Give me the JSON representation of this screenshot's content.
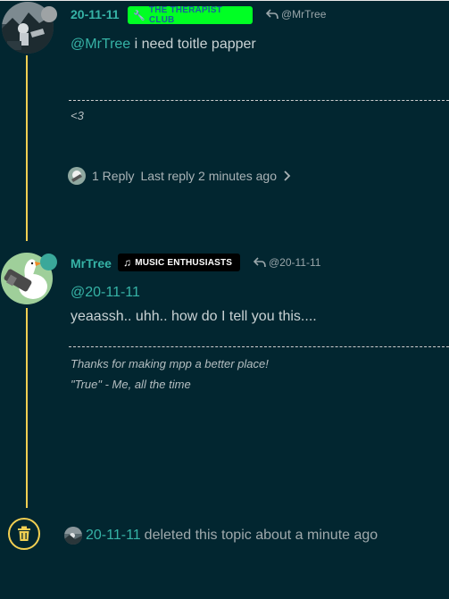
{
  "post1": {
    "username": "20-11-11",
    "badge": {
      "label": "THE THERAPIST CLUB",
      "bg": "#00ff24",
      "fg": "#1b5e9f",
      "icon": "wrench-icon"
    },
    "reply_to": "@MrTree",
    "mention": "@MrTree",
    "body": " i need toitle papper",
    "signature": "<3",
    "replies_label": "1 Reply",
    "last_reply": "Last reply 2 minutes ago"
  },
  "post2": {
    "username": "MrTree",
    "badge": {
      "label": "MUSIC ENTHUSIASTS",
      "bg": "#000000",
      "fg": "#ffffff",
      "icon": "music-note-icon"
    },
    "reply_to": "@20-11-11",
    "mention": "@20-11-11",
    "body": "yeaassh.. uhh.. how do I tell you this....",
    "signature_line1": "Thanks for making mpp a better place!",
    "signature_line2": "\"True\" - Me, all the time"
  },
  "event": {
    "user": "20-11-11",
    "text": " deleted this topic about a minute ago",
    "icon": "trash-icon"
  },
  "colors": {
    "background": "#022630",
    "accent": "#36b3a6",
    "timeline": "#f2cf52",
    "text": "#c9d2d4",
    "status_offline": "#9ea3a5",
    "status_online": "#3aa89a"
  }
}
